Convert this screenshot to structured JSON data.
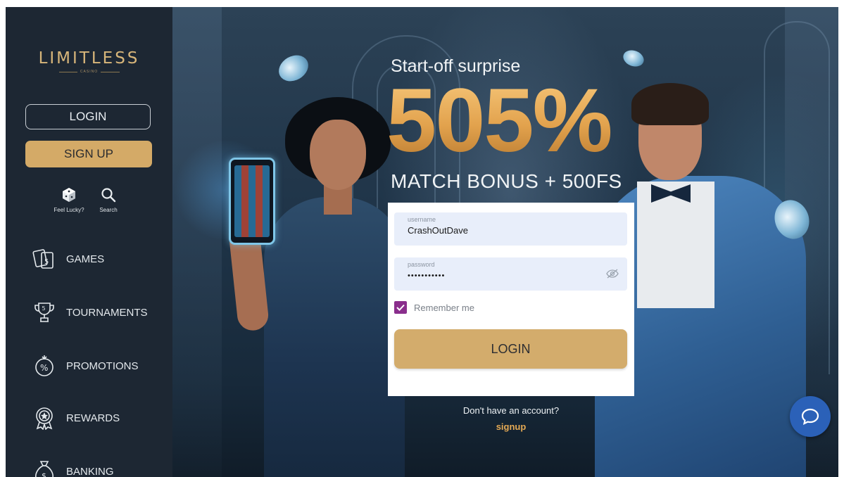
{
  "brand": {
    "logo_text": "LIMITLESS",
    "logo_subtext": "CASINO"
  },
  "sidebar": {
    "login_label": "LOGIN",
    "signup_label": "SIGN UP",
    "utilities": [
      {
        "label": "Feel Lucky?",
        "icon": "dice-icon"
      },
      {
        "label": "Search",
        "icon": "search-icon"
      }
    ],
    "nav": [
      {
        "label": "GAMES",
        "icon": "cards-icon"
      },
      {
        "label": "TOURNAMENTS",
        "icon": "trophy-icon"
      },
      {
        "label": "PROMOTIONS",
        "icon": "percent-badge-icon"
      },
      {
        "label": "REWARDS",
        "icon": "medal-icon"
      },
      {
        "label": "BANKING",
        "icon": "money-bag-icon"
      }
    ]
  },
  "hero": {
    "subtitle": "Start-off surprise",
    "headline": "505%",
    "bonus": "MATCH BONUS + 500FS"
  },
  "login_form": {
    "username_label": "username",
    "username_value": "CrashOutDave",
    "password_label": "password",
    "password_value": "•••••••••••",
    "remember_label": "Remember me",
    "remember_checked": true,
    "submit_label": "LOGIN",
    "no_account_text": "Don't have an account?",
    "signup_link": "signup"
  },
  "colors": {
    "sidebar_bg": "#1d2733",
    "gold": "#d4aa67",
    "headline": "#e4a954",
    "checkbox": "#8a2e8c",
    "chat_button": "#2b61b8"
  }
}
